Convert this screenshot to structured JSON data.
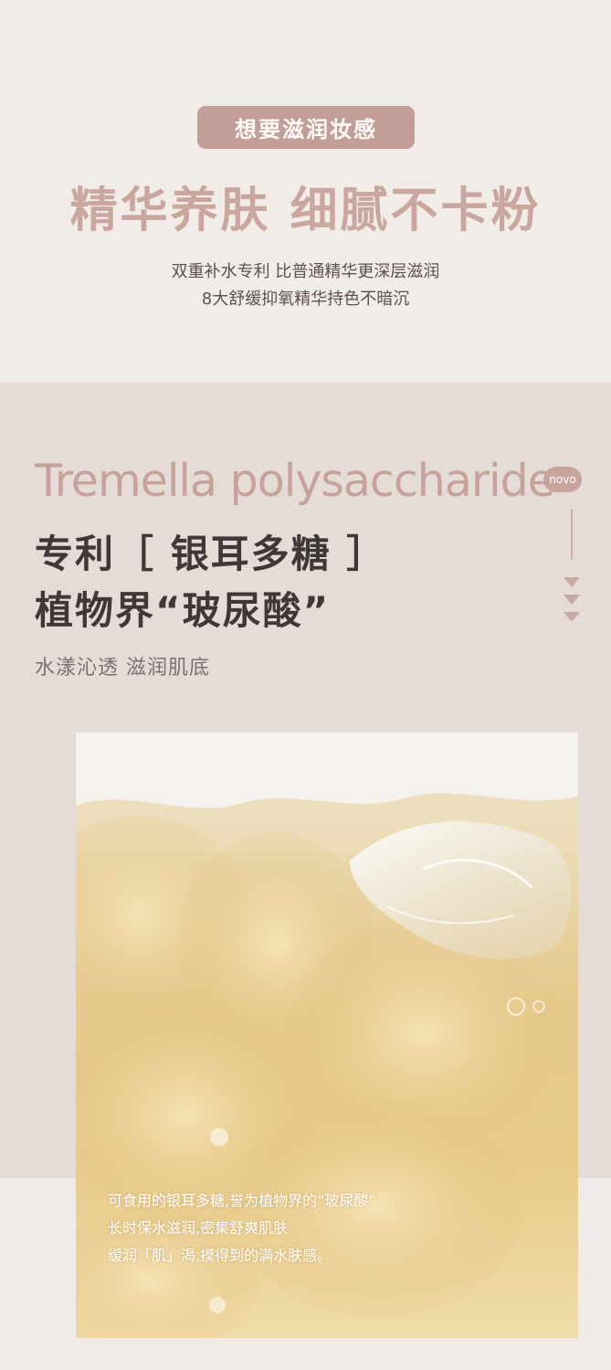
{
  "header": {
    "pill_label": "想要滋润妆感",
    "headline": "精华养肤 细腻不卡粉",
    "sub_line_1": "双重补水专利 比普通精华更深层滋润",
    "sub_line_2": "8大舒缓抑氧精华持色不暗沉"
  },
  "feature": {
    "english_title": "Tremella polysaccharide",
    "brand_logo": "novo",
    "title_line_1": "专利［ 银耳多糖 ］",
    "title_line_2": "植物界“玻尿酸”",
    "tagline": "水漾沁透 滋润肌底"
  },
  "photo": {
    "caption_line_1": "可食用的银耳多糖,誉为植物界的“玻尿酸”",
    "caption_line_2": "长时保水滋润,密集舒爽肌肤",
    "caption_line_3": "缓润「肌」渴,摸得到的满水肤感。"
  },
  "colors": {
    "accent_rose": "#c19f98",
    "headline_rose": "#c9a79f",
    "band_background": "#e6dcd7",
    "page_background": "#f1ece7",
    "dark_text": "#3f3838"
  },
  "icons": [
    "down-arrow-icon",
    "vertical-divider"
  ]
}
